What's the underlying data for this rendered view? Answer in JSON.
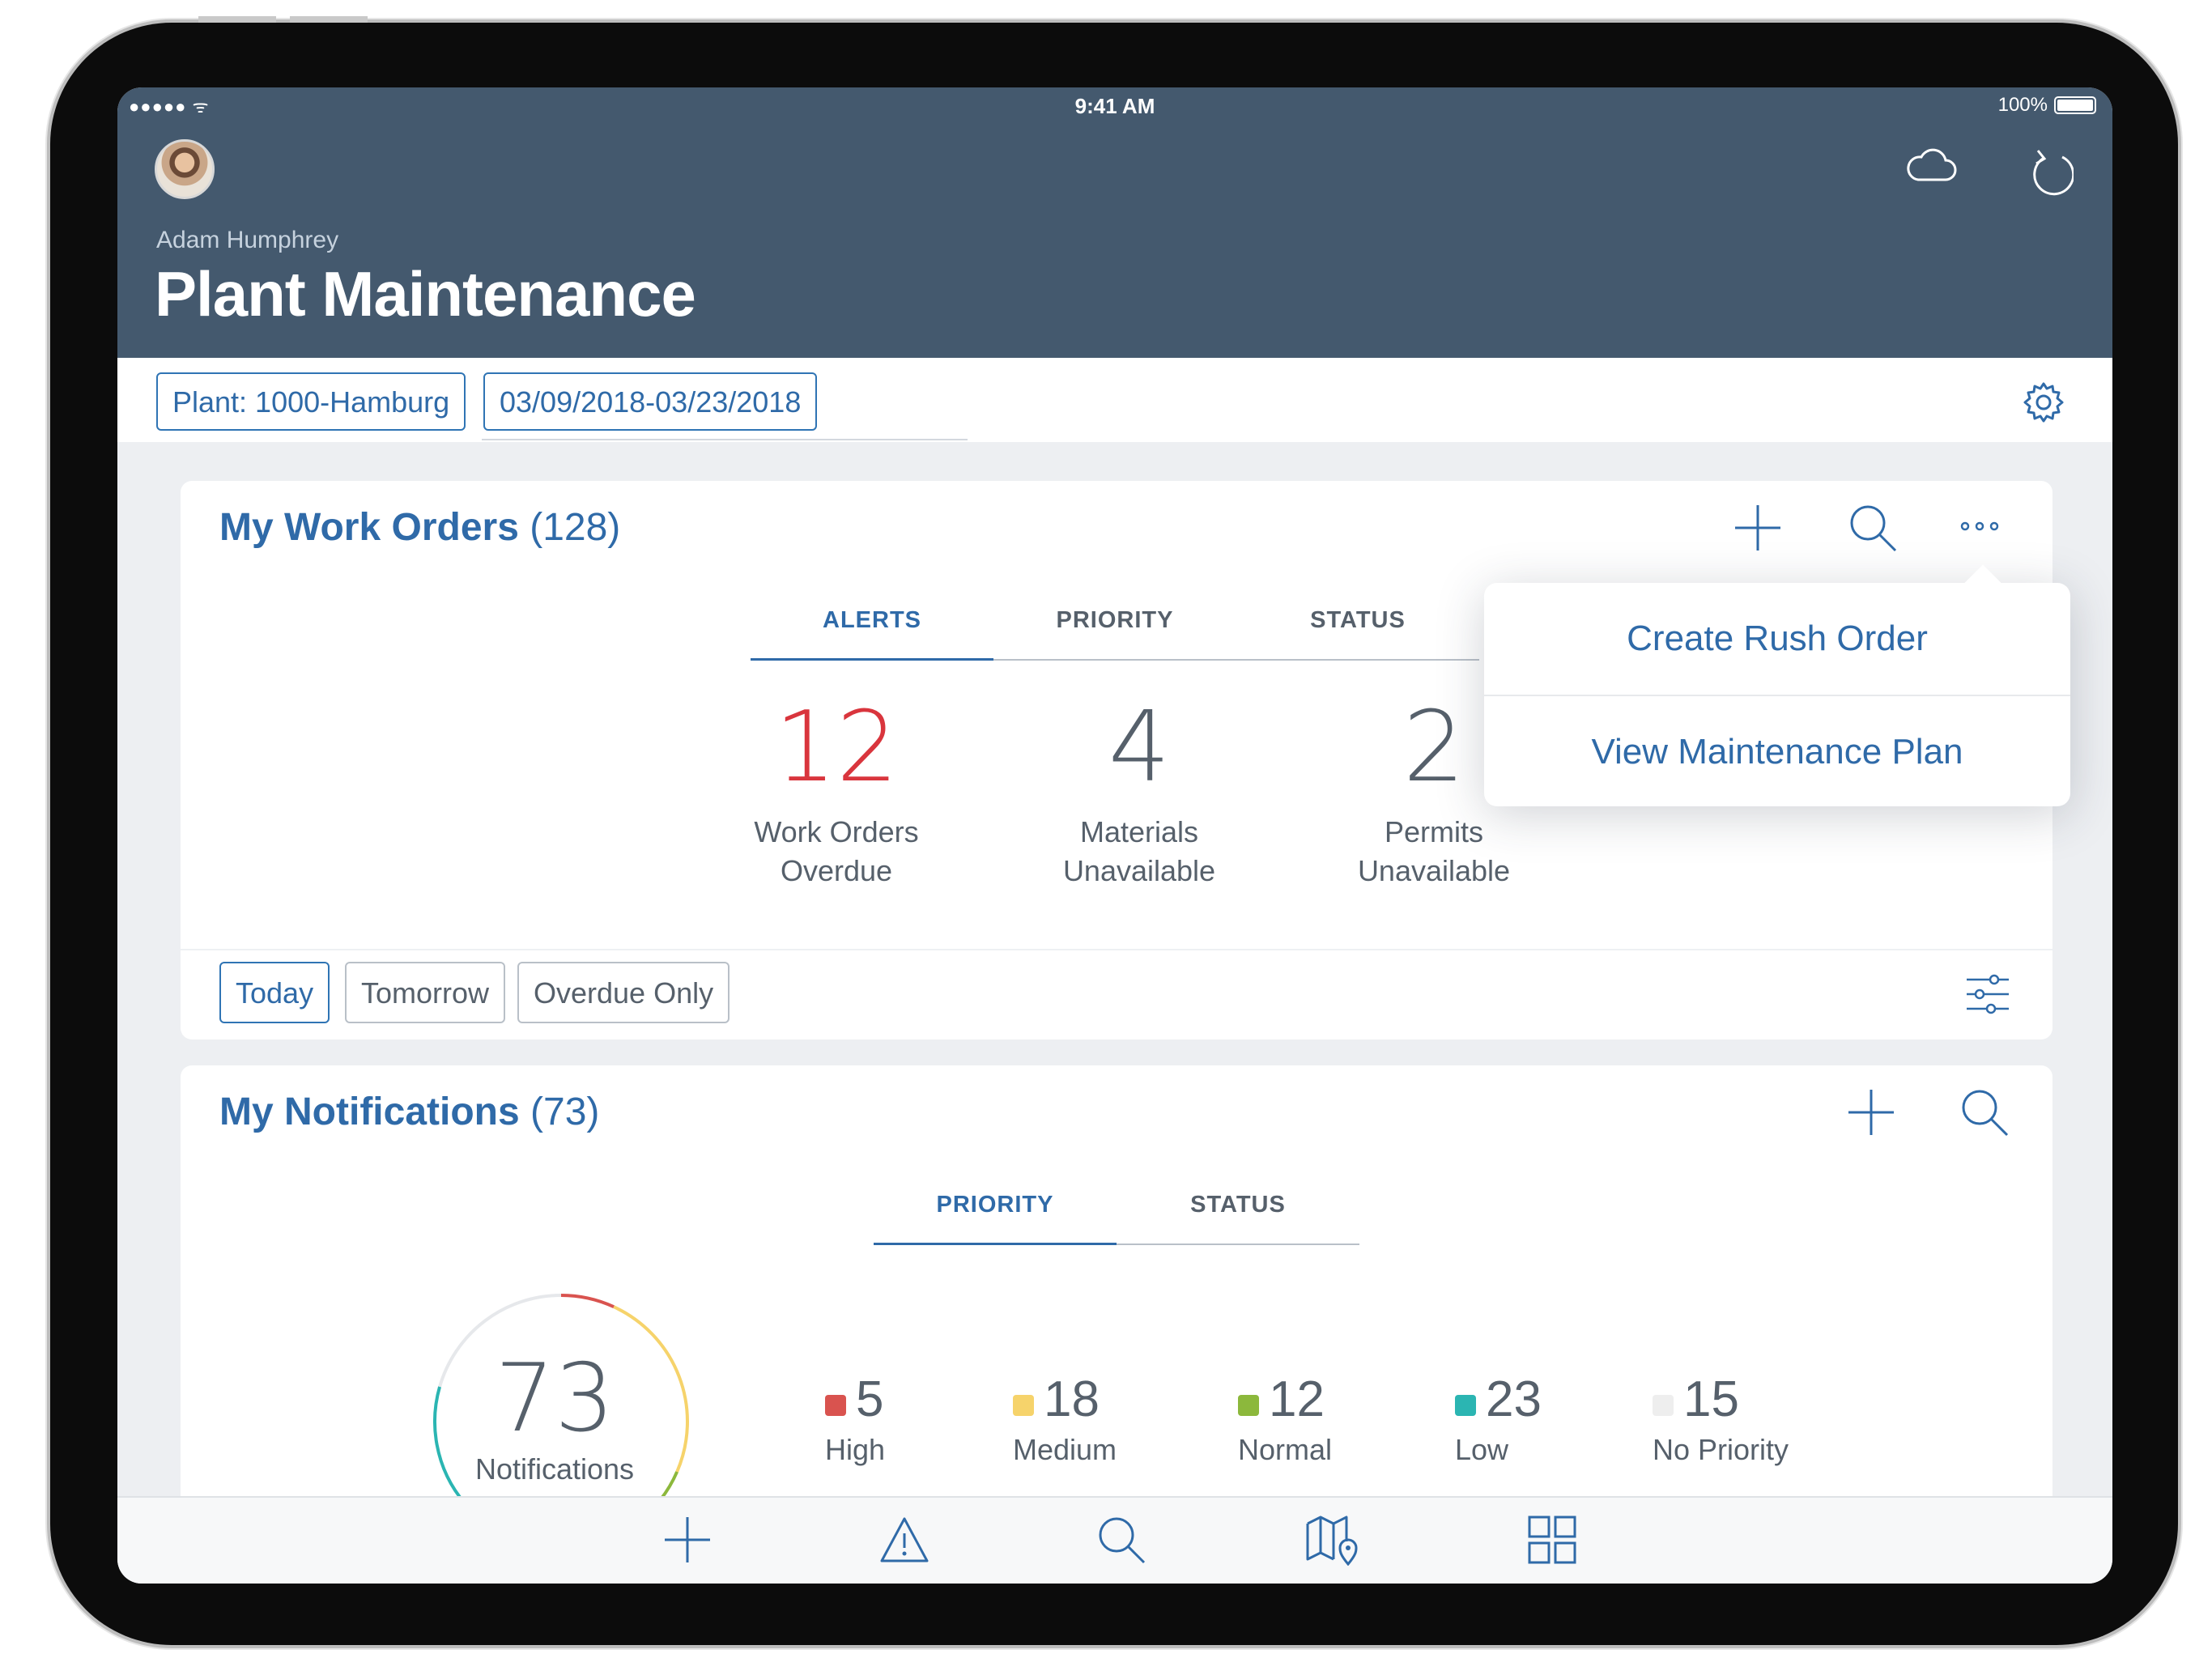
{
  "status_bar": {
    "signal": "●●●●● ᯤ",
    "time": "9:41 AM",
    "battery": "100%"
  },
  "header": {
    "user_name": "Adam Humphrey",
    "title": "Plant Maintenance"
  },
  "filters": {
    "plant": "Plant: 1000-Hamburg",
    "date_range": "03/09/2018-03/23/2018"
  },
  "work_orders": {
    "title": "My Work Orders",
    "count": "(128)",
    "tabs": [
      "ALERTS",
      "PRIORITY",
      "STATUS"
    ],
    "active_tab": "ALERTS",
    "kpis": [
      {
        "value": "12",
        "label": "Work Orders Overdue",
        "color": "#d9353d"
      },
      {
        "value": "4",
        "label": "Materials Unavailable"
      },
      {
        "value": "2",
        "label": "Permits Unavailable"
      }
    ],
    "chips": [
      "Today",
      "Tomorrow",
      "Overdue Only"
    ],
    "active_chip": "Today"
  },
  "popover": {
    "items": [
      "Create Rush Order",
      "View Maintenance Plan"
    ]
  },
  "notifications": {
    "title": "My Notifications",
    "count": "(73)",
    "tabs": [
      "PRIORITY",
      "STATUS"
    ],
    "active_tab": "PRIORITY",
    "total_value": "73",
    "total_label": "Notifications",
    "legend": [
      {
        "value": "5",
        "label": "High",
        "color": "#d9534f"
      },
      {
        "value": "18",
        "label": "Medium",
        "color": "#f6d36b"
      },
      {
        "value": "12",
        "label": "Normal",
        "color": "#8cb83c"
      },
      {
        "value": "23",
        "label": "Low",
        "color": "#2bb5b2"
      },
      {
        "value": "15",
        "label": "No Priority",
        "color": "#eeeeee"
      }
    ]
  },
  "colors": {
    "header_bg": "#44596e",
    "accent": "#2f6aa8",
    "text": "#56606b",
    "background": "#edeff2"
  },
  "tab_bar": {
    "icons": [
      "plus-icon",
      "warning-icon",
      "search-icon",
      "map-icon",
      "grid-icon"
    ]
  }
}
